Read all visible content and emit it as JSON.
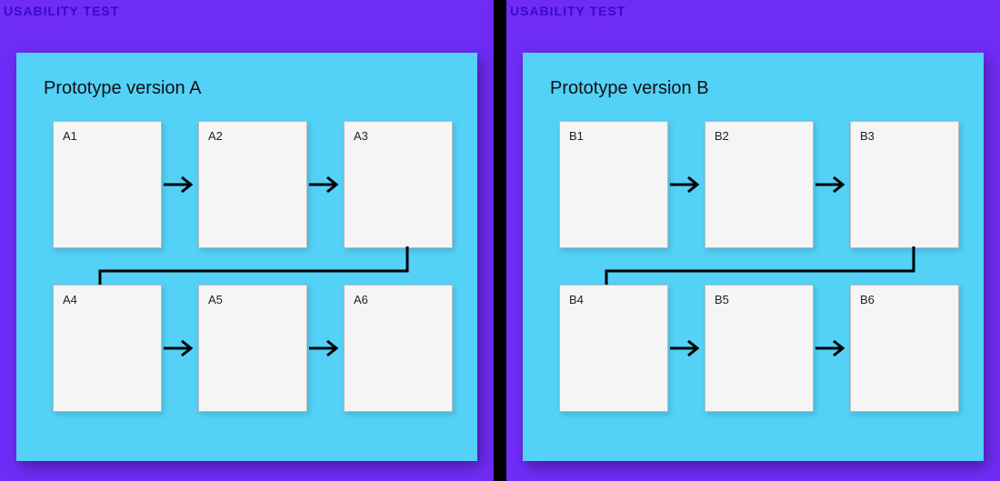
{
  "panels": [
    {
      "label": "USABILITY TEST",
      "prototype_title": "Prototype version A",
      "screens_row1": [
        "A1",
        "A2",
        "A3"
      ],
      "screens_row2": [
        "A4",
        "A5",
        "A6"
      ]
    },
    {
      "label": "USABILITY TEST",
      "prototype_title": "Prototype version B",
      "screens_row1": [
        "B1",
        "B2",
        "B3"
      ],
      "screens_row2": [
        "B4",
        "B5",
        "B6"
      ]
    }
  ],
  "colors": {
    "panel_bg": "#6f2cf6",
    "panel_label": "#3a07d0",
    "card_bg": "#54d1f6",
    "screen_bg": "#f5f5f5"
  }
}
